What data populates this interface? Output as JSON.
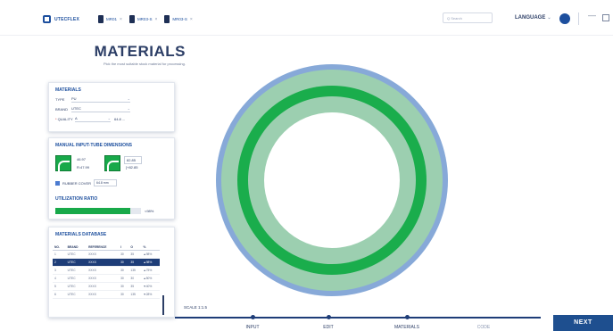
{
  "app": {
    "logo_text": "UTECFLEX"
  },
  "tabs": [
    {
      "label": "MR01",
      "close": "×"
    },
    {
      "label": "MR03-S",
      "close": "×"
    },
    {
      "label": "MR03-S",
      "close": "×"
    }
  ],
  "search": {
    "placeholder": "Q Search"
  },
  "language": {
    "label": "LANGUAGE",
    "caret": "⌄"
  },
  "window": {
    "minimize": "—"
  },
  "page": {
    "title": "MATERIALS",
    "subtitle": "Pick the most suitable stock material for processing."
  },
  "materials": {
    "title": "MATERIALS",
    "type": {
      "label": "TYPE",
      "value": "PU"
    },
    "brand": {
      "label": "BRAND",
      "value": "UTEC"
    },
    "quality": {
      "required_mark": "*",
      "label": "QUALITY",
      "value": "A",
      "unit_value": "64.8 ..."
    }
  },
  "dimensions": {
    "title": "MANUAL INPUT-TUBE DIMENSIONS",
    "tube1": {
      "a": "46.97",
      "b": "R:47.99"
    },
    "tube2": {
      "a": "82.85",
      "b": "[+82.85"
    },
    "rubber_cover": {
      "label": "RUBBER COVER",
      "value": "64.8 mm"
    }
  },
  "utilization": {
    "title": "UTILIZATION RATIO",
    "percent": 0.88,
    "label": "<98%"
  },
  "database": {
    "title": "MATERIALS DATABASE",
    "columns": [
      "NO.",
      "BRAND",
      "REFERENCE",
      "I",
      "O",
      "%"
    ],
    "rows": [
      {
        "no": "1",
        "brand": "UTEC",
        "ref": "XXXX",
        "i": "30",
        "o": "35",
        "pct": "▲98%",
        "dir": "up"
      },
      {
        "no": "2",
        "brand": "UTEC",
        "ref": "XXXX",
        "i": "30",
        "o": "35",
        "pct": "▲98%",
        "dir": "up",
        "selected": true
      },
      {
        "no": "3",
        "brand": "UTEC",
        "ref": "XXXX",
        "i": "30",
        "o": "135",
        "pct": "▲75%",
        "dir": "up"
      },
      {
        "no": "4",
        "brand": "UTEC",
        "ref": "XXXX",
        "i": "30",
        "o": "30",
        "pct": "▲50%",
        "dir": "up"
      },
      {
        "no": "5",
        "brand": "UTEC",
        "ref": "XXXX",
        "i": "30",
        "o": "35",
        "pct": "▼40%",
        "dir": "down"
      },
      {
        "no": "6",
        "brand": "UTEC",
        "ref": "XXXX",
        "i": "30",
        "o": "135",
        "pct": "▼28%",
        "dir": "down"
      }
    ]
  },
  "canvas": {
    "scale": "SCALE 1:1.5",
    "colors": {
      "outer": "#87a9d8",
      "light": "#9ccfb0",
      "dark": "#1aad4c"
    }
  },
  "stepper": {
    "steps": [
      {
        "label": "INPUT",
        "done": true
      },
      {
        "label": "EDIT",
        "done": true
      },
      {
        "label": "MATERIALS",
        "done": true
      },
      {
        "label": "CODE",
        "done": false
      }
    ]
  },
  "next_button": {
    "label": "NEXT"
  }
}
